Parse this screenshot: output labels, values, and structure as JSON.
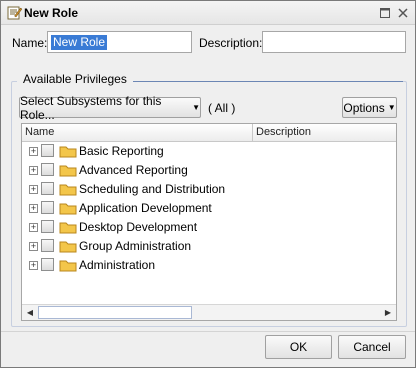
{
  "window": {
    "title": "New Role"
  },
  "form": {
    "name_label": "Name:",
    "name_value": "New Role",
    "description_label": "Description:",
    "description_value": ""
  },
  "privileges": {
    "group_label": "Available Privileges",
    "subsystems_button": "Select Subsystems for this Role...",
    "subsystems_filter": "( All )",
    "options_button": "Options",
    "columns": {
      "name": "Name",
      "description": "Description"
    },
    "items": [
      {
        "label": "Basic Reporting"
      },
      {
        "label": "Advanced Reporting"
      },
      {
        "label": "Scheduling and Distribution"
      },
      {
        "label": "Application Development"
      },
      {
        "label": "Desktop Development"
      },
      {
        "label": "Group Administration"
      },
      {
        "label": "Administration"
      }
    ]
  },
  "footer": {
    "ok_label": "OK",
    "cancel_label": "Cancel"
  },
  "icons": {
    "title": "role-icon",
    "maximize": "maximize-icon",
    "close": "close-icon",
    "expand": "plus-expand-icon",
    "folder": "folder-icon"
  },
  "colors": {
    "selection": "#3a7bd5",
    "folder": "#f3c64a",
    "group_border": "#6c86b4"
  }
}
